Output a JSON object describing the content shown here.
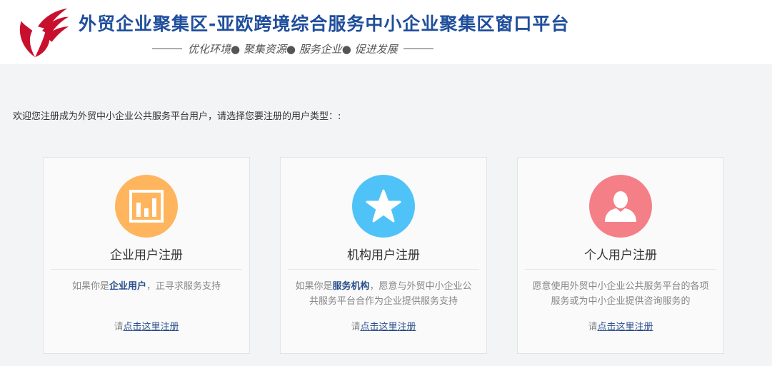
{
  "header": {
    "title": "外贸企业聚集区-亚欧跨境综合服务中小企业聚集区窗口平台",
    "slogan": "优化环境● 聚集资源● 服务企业● 促进发展"
  },
  "intro": "欢迎您注册成为外贸中小企业公共服务平台用户，请选择您要注册的用户类型：:",
  "colors": {
    "brand": "#1f4e9c",
    "enterprise": "#ffb55e",
    "institution": "#4fc3f7",
    "personal": "#f47f87",
    "link": "#2a4e8c"
  },
  "cards": [
    {
      "icon": "bar-chart-icon",
      "title": "企业用户注册",
      "desc_pre": "如果你是",
      "desc_bold": "企业用户",
      "desc_post": "，正寻求服务支持",
      "reg_prefix": "请",
      "reg_link": "点击这里注册"
    },
    {
      "icon": "star-icon",
      "title": "机构用户注册",
      "desc_pre": "如果你是",
      "desc_bold": "服务机构",
      "desc_post": "，愿意与外贸中小企业公共服务平台合作为企业提供服务支持",
      "reg_prefix": "请",
      "reg_link": "点击这里注册"
    },
    {
      "icon": "user-icon",
      "title": "个人用户注册",
      "desc_text": "愿意使用外贸中小企业公共服务平台的各项服务或为中小企业提供咨询服务的",
      "reg_prefix": "请",
      "reg_link": "点击这里注册"
    }
  ]
}
